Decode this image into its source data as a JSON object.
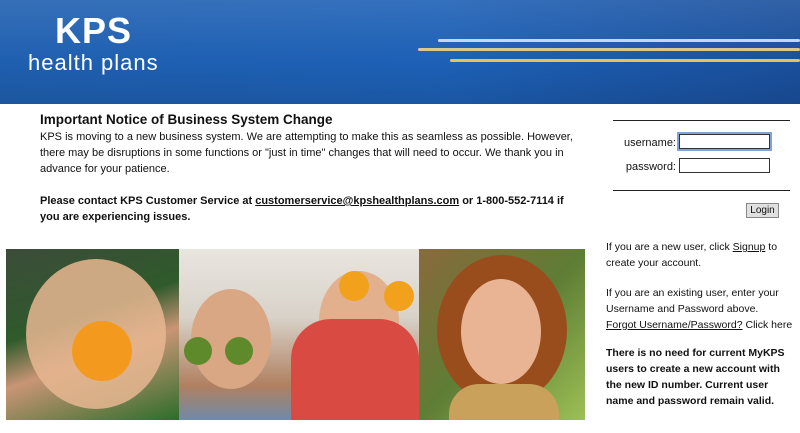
{
  "header": {
    "logo_main": "KPS",
    "logo_sub": "health plans"
  },
  "notice": {
    "title": "Important Notice of Business System Change",
    "body": "KPS is moving to a new business system. We are attempting to make this as seamless as possible. However, there may be disruptions in some functions or \"just in time\" changes that will need to occur. We thank you in advance for your patience.",
    "contact_prefix": "Please contact KPS Customer Service at ",
    "contact_email": "customerservice@kpshealthplans.com",
    "contact_middle": " or 1-800-552-7114 if you are experiencing issues."
  },
  "login": {
    "username_label": "username:",
    "password_label": "password:",
    "username_value": "",
    "password_value": "",
    "button_label": "Login"
  },
  "help": {
    "new_user_prefix": "If you are a new user, click ",
    "new_user_link": "Signup",
    "new_user_suffix": " to create your account.",
    "existing_user_text": "If you are an existing user, enter your Username and Password above.",
    "forgot_link": "Forgot Username/Password?",
    "forgot_suffix": " Click here",
    "notice_text": "There is no need for current MyKPS users to create a new account with the new ID number.  Current user name and password remain valid."
  },
  "colors": {
    "header_blue": "#1f5fb0",
    "stripe_gold": "#e5c25a"
  }
}
